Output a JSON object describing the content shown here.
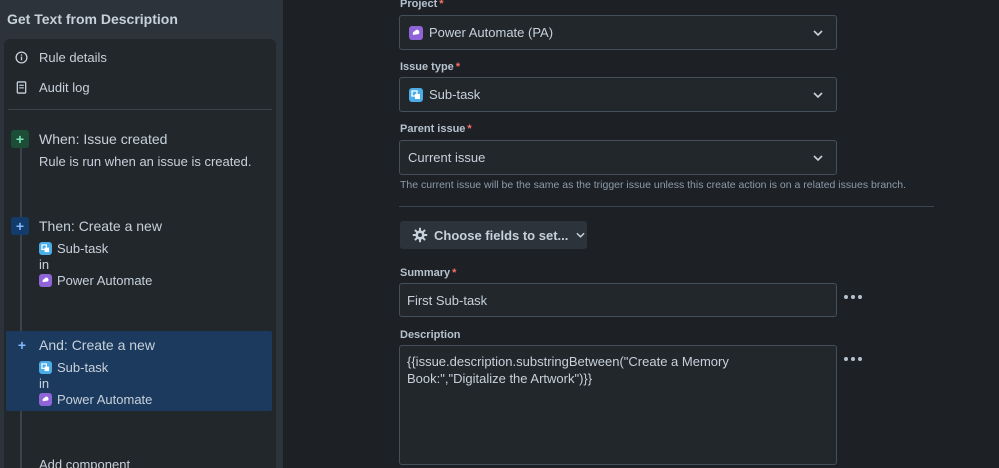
{
  "sidebar": {
    "rule_title": "Get Text from Description",
    "menu": [
      {
        "label": "Rule details",
        "icon": "info-icon"
      },
      {
        "label": "Audit log",
        "icon": "document-icon"
      }
    ],
    "steps": [
      {
        "title": "When: Issue created",
        "subtitle": "Rule is run when an issue is created."
      },
      {
        "title": "Then: Create a new",
        "issue_type": "Sub-task",
        "in": "in",
        "project": "Power Automate"
      },
      {
        "title": "And: Create a new",
        "issue_type": "Sub-task",
        "in": "in",
        "project": "Power Automate"
      }
    ],
    "add_component": "Add component"
  },
  "form": {
    "project": {
      "label": "Project",
      "value": "Power Automate (PA)"
    },
    "issue_type": {
      "label": "Issue type",
      "value": "Sub-task"
    },
    "parent_issue": {
      "label": "Parent issue",
      "value": "Current issue",
      "help": "The current issue will be the same as the trigger issue unless this create action is on a related issues branch."
    },
    "choose_fields_label": "Choose fields to set...",
    "summary": {
      "label": "Summary",
      "value": "First Sub-task"
    },
    "description": {
      "label": "Description",
      "value": "{{issue.description.substringBetween(\"Create a Memory Book:\",\"Digitalize the Artwork\")}}"
    }
  },
  "colors": {
    "background": "#1d2125",
    "sidebar": "#2c333a",
    "highlight": "#1c3a5e",
    "required": "#f87168",
    "subtask_icon": "#4bade8",
    "project_icon": "#8e64d8"
  }
}
